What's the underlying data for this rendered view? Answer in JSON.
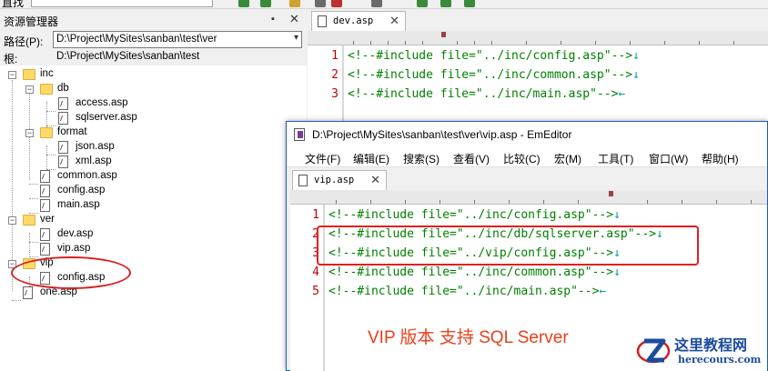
{
  "toolbar": {
    "partial_label": "直找"
  },
  "explorer": {
    "title": "资源管理器",
    "path_label": "路径(P):",
    "path_value": "D:\\Project\\MySites\\sanban\\test\\ver",
    "root_label": "根:",
    "root_value": "D:\\Project\\MySites\\sanban\\test",
    "tree": {
      "inc": "inc",
      "db": "db",
      "access": "access.asp",
      "sqlserver": "sqlserver.asp",
      "format": "format",
      "json": "json.asp",
      "xml": "xml.asp",
      "common": "common.asp",
      "config": "config.asp",
      "main": "main.asp",
      "ver": "ver",
      "dev": "dev.asp",
      "vip": "vip.asp",
      "vipfolder": "vip",
      "vipconfig": "config.asp",
      "one": "one.asp"
    }
  },
  "back_editor": {
    "tab": "dev.asp",
    "lines": [
      {
        "n": "1",
        "code": "<!--#include file=\"../inc/config.asp\"-->",
        "nl": "↓"
      },
      {
        "n": "2",
        "code": "<!--#include file=\"../inc/common.asp\"-->",
        "nl": "↓"
      },
      {
        "n": "3",
        "code": "<!--#include file=\"../inc/main.asp\"-->",
        "nl": "←"
      }
    ]
  },
  "front_window": {
    "title": "D:\\Project\\MySites\\sanban\\test\\ver\\vip.asp - EmEditor",
    "menu": [
      "文件(F)",
      "编辑(E)",
      "搜索(S)",
      "查看(V)",
      "比较(C)",
      "宏(M)",
      "工具(T)",
      "窗口(W)",
      "帮助(H)"
    ],
    "tab": "vip.asp",
    "lines": [
      {
        "n": "1",
        "code": "<!--#include file=\"../inc/config.asp\"-->",
        "nl": "↓"
      },
      {
        "n": "2",
        "code": "<!--#include file=\"../inc/db/sqlserver.asp\"-->",
        "nl": "↓"
      },
      {
        "n": "3",
        "code": "<!--#include file=\"../vip/config.asp\"-->",
        "nl": "↓"
      },
      {
        "n": "4",
        "code": "<!--#include file=\"../inc/common.asp\"-->",
        "nl": "↓"
      },
      {
        "n": "5",
        "code": "<!--#include file=\"../inc/main.asp\"-->",
        "nl": "←"
      }
    ]
  },
  "caption": "VIP 版本 支持 SQL Server",
  "watermark": {
    "name": "这里教程网",
    "url": "herecours.com"
  },
  "colors": {
    "annotation": "#e02020",
    "code": "#008000",
    "line_number": "#c00000",
    "caption": "#e8401c"
  }
}
